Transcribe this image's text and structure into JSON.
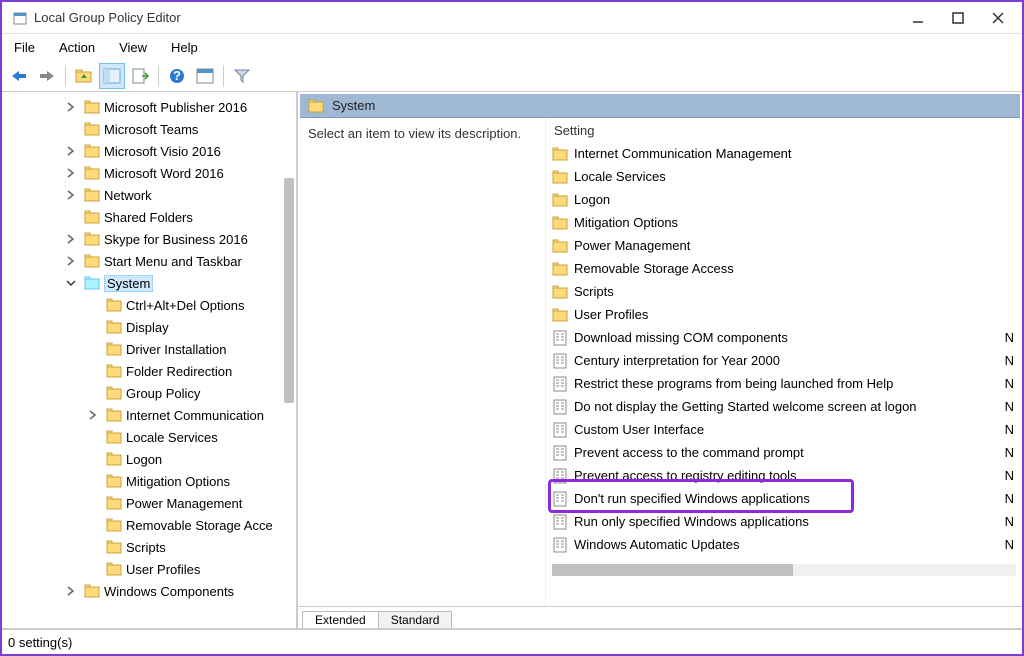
{
  "window": {
    "title": "Local Group Policy Editor"
  },
  "menubar": [
    "File",
    "Action",
    "View",
    "Help"
  ],
  "tree": [
    {
      "indent": 1,
      "exp": "›",
      "label": "Microsoft Publisher 2016"
    },
    {
      "indent": 1,
      "exp": "",
      "label": "Microsoft Teams"
    },
    {
      "indent": 1,
      "exp": "›",
      "label": "Microsoft Visio 2016"
    },
    {
      "indent": 1,
      "exp": "›",
      "label": "Microsoft Word 2016"
    },
    {
      "indent": 1,
      "exp": "›",
      "label": "Network"
    },
    {
      "indent": 1,
      "exp": "",
      "label": "Shared Folders"
    },
    {
      "indent": 1,
      "exp": "›",
      "label": "Skype for Business 2016"
    },
    {
      "indent": 1,
      "exp": "›",
      "label": "Start Menu and Taskbar"
    },
    {
      "indent": 1,
      "exp": "⌄",
      "label": "System",
      "selected": true
    },
    {
      "indent": 2,
      "exp": "",
      "label": "Ctrl+Alt+Del Options"
    },
    {
      "indent": 2,
      "exp": "",
      "label": "Display"
    },
    {
      "indent": 2,
      "exp": "",
      "label": "Driver Installation"
    },
    {
      "indent": 2,
      "exp": "",
      "label": "Folder Redirection"
    },
    {
      "indent": 2,
      "exp": "",
      "label": "Group Policy"
    },
    {
      "indent": 2,
      "exp": "›",
      "label": "Internet Communication"
    },
    {
      "indent": 2,
      "exp": "",
      "label": "Locale Services"
    },
    {
      "indent": 2,
      "exp": "",
      "label": "Logon"
    },
    {
      "indent": 2,
      "exp": "",
      "label": "Mitigation Options"
    },
    {
      "indent": 2,
      "exp": "",
      "label": "Power Management"
    },
    {
      "indent": 2,
      "exp": "",
      "label": "Removable Storage Acce"
    },
    {
      "indent": 2,
      "exp": "",
      "label": "Scripts"
    },
    {
      "indent": 2,
      "exp": "",
      "label": "User Profiles"
    },
    {
      "indent": 1,
      "exp": "›",
      "label": "Windows Components"
    }
  ],
  "header": {
    "path": "System"
  },
  "description": "Select an item to view its description.",
  "list_header": "Setting",
  "settings": [
    {
      "type": "folder",
      "name": "Internet Communication Management"
    },
    {
      "type": "folder",
      "name": "Locale Services"
    },
    {
      "type": "folder",
      "name": "Logon"
    },
    {
      "type": "folder",
      "name": "Mitigation Options"
    },
    {
      "type": "folder",
      "name": "Power Management"
    },
    {
      "type": "folder",
      "name": "Removable Storage Access"
    },
    {
      "type": "folder",
      "name": "Scripts"
    },
    {
      "type": "folder",
      "name": "User Profiles"
    },
    {
      "type": "policy",
      "name": "Download missing COM components",
      "state": "N"
    },
    {
      "type": "policy",
      "name": "Century interpretation for Year 2000",
      "state": "N"
    },
    {
      "type": "policy",
      "name": "Restrict these programs from being launched from Help",
      "state": "N"
    },
    {
      "type": "policy",
      "name": "Do not display the Getting Started welcome screen at logon",
      "state": "N"
    },
    {
      "type": "policy",
      "name": "Custom User Interface",
      "state": "N"
    },
    {
      "type": "policy",
      "name": "Prevent access to the command prompt",
      "state": "N"
    },
    {
      "type": "policy",
      "name": "Prevent access to registry editing tools",
      "state": "N"
    },
    {
      "type": "policy",
      "name": "Don't run specified Windows applications",
      "state": "N",
      "highlighted": true
    },
    {
      "type": "policy",
      "name": "Run only specified Windows applications",
      "state": "N"
    },
    {
      "type": "policy",
      "name": "Windows Automatic Updates",
      "state": "N"
    }
  ],
  "tabs": {
    "extended": "Extended",
    "standard": "Standard"
  },
  "footer": "0 setting(s)"
}
